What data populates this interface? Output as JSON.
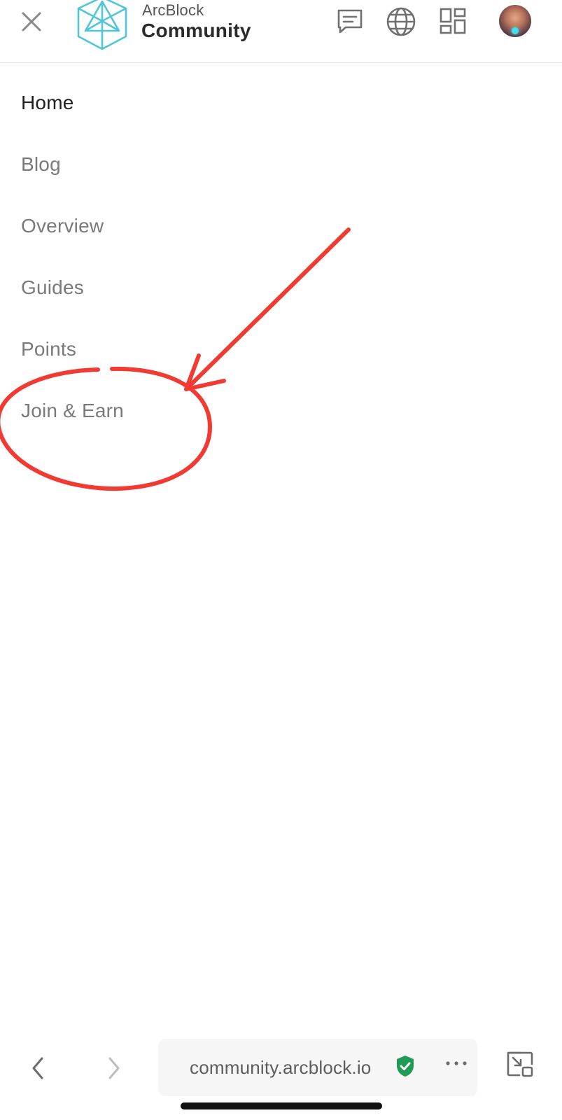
{
  "header": {
    "brand_top": "ArcBlock",
    "brand_bottom": "Community",
    "icons": [
      "close-icon",
      "logo-icon",
      "chat-icon",
      "globe-icon",
      "apps-grid-icon",
      "avatar"
    ]
  },
  "menu": {
    "items": [
      {
        "label": "Home",
        "active": true
      },
      {
        "label": "Blog",
        "active": false
      },
      {
        "label": "Overview",
        "active": false
      },
      {
        "label": "Guides",
        "active": false
      },
      {
        "label": "Points",
        "active": false
      },
      {
        "label": "Join & Earn",
        "active": false
      }
    ]
  },
  "annotation": {
    "color": "#f03a32",
    "target": "Join & Earn"
  },
  "browser": {
    "url": "community.arcblock.io",
    "icons": [
      "back-icon",
      "forward-icon",
      "secure-shield-icon",
      "more-icon",
      "pip-icon"
    ]
  },
  "colors": {
    "logo_teal": "#4fc6d8",
    "secure_green": "#1f9d55",
    "menu_text": "#7a7a7a",
    "menu_active": "#1f1f1f"
  }
}
